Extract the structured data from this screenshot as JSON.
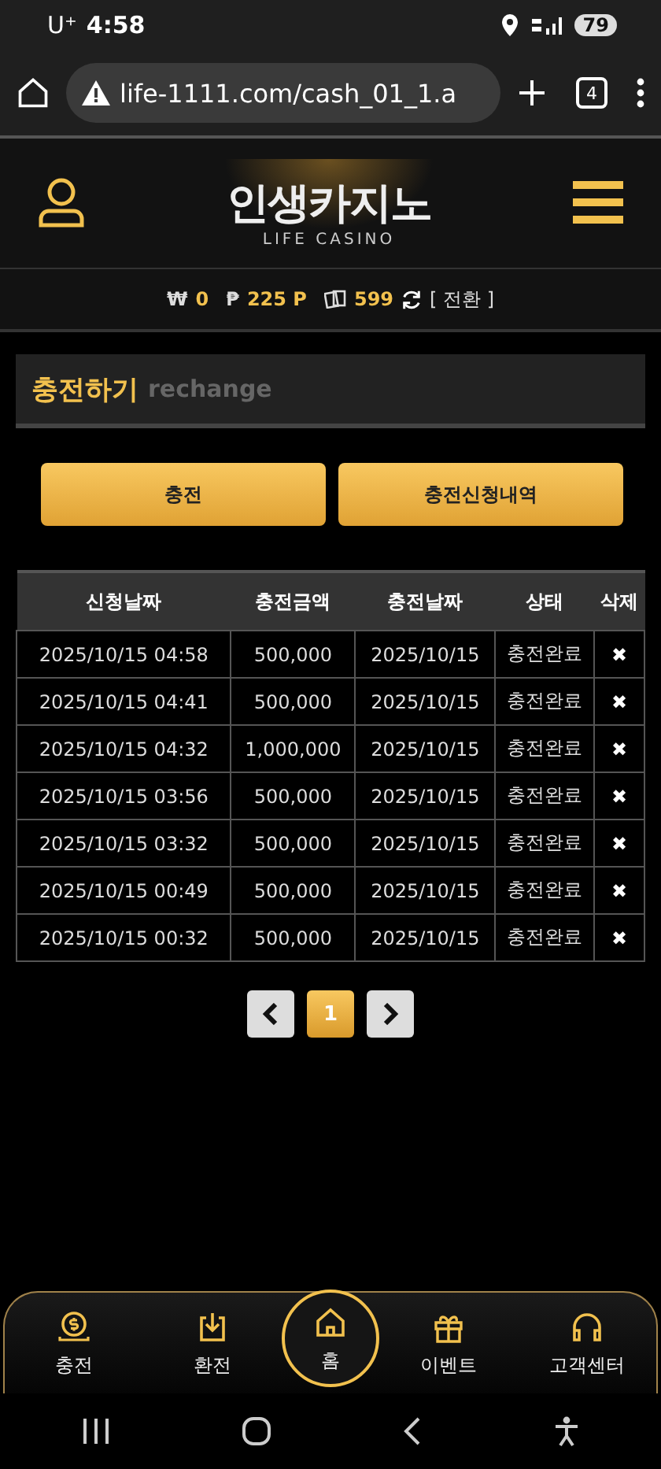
{
  "status_bar": {
    "carrier": "U⁺",
    "time": "4:58",
    "battery": "79"
  },
  "browser": {
    "url": "life-1111.com/cash_01_1.a",
    "tab_count": "4"
  },
  "header": {
    "logo_title": "인생카지노",
    "logo_subtitle": "LIFE CASINO"
  },
  "balance": {
    "won_symbol": "₩",
    "won": "0",
    "point_symbol": "₱",
    "points": "225 P",
    "chips": "599",
    "convert": "[ 전환 ]"
  },
  "section": {
    "title": "충전하기",
    "subtitle": "rechange"
  },
  "buttons": [
    "충전",
    "충전신청내역"
  ],
  "table": {
    "columns": [
      "신청날짜",
      "충전금액",
      "충전날짜",
      "상태",
      "삭제"
    ],
    "rows": [
      [
        "2025/10/15 04:58",
        "500,000",
        "2025/10/15",
        "충전완료",
        "✖"
      ],
      [
        "2025/10/15 04:41",
        "500,000",
        "2025/10/15",
        "충전완료",
        "✖"
      ],
      [
        "2025/10/15 04:32",
        "1,000,000",
        "2025/10/15",
        "충전완료",
        "✖"
      ],
      [
        "2025/10/15 03:56",
        "500,000",
        "2025/10/15",
        "충전완료",
        "✖"
      ],
      [
        "2025/10/15 03:32",
        "500,000",
        "2025/10/15",
        "충전완료",
        "✖"
      ],
      [
        "2025/10/15 00:49",
        "500,000",
        "2025/10/15",
        "충전완료",
        "✖"
      ],
      [
        "2025/10/15 00:32",
        "500,000",
        "2025/10/15",
        "충전완료",
        "✖"
      ]
    ]
  },
  "pagination": {
    "pages": [
      {
        "label": "1",
        "selected": true
      }
    ]
  },
  "bottom_nav": [
    {
      "label": "충전",
      "selected": false
    },
    {
      "label": "환전",
      "selected": false
    },
    {
      "label": "홈",
      "selected": true
    },
    {
      "label": "이벤트",
      "selected": false
    },
    {
      "label": "고객센터",
      "selected": false
    }
  ]
}
